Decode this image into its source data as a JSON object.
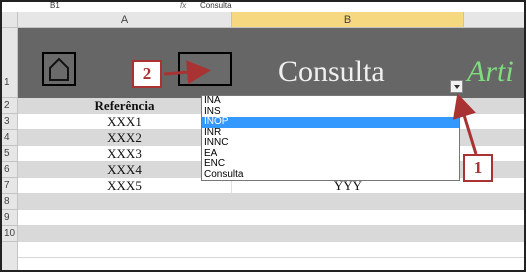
{
  "formula_bar": {
    "namebox": "B1",
    "fx": "fx",
    "content": "Consulta"
  },
  "columns": [
    "A",
    "B"
  ],
  "rows": [
    "1",
    "2",
    "3",
    "4",
    "5",
    "6",
    "7",
    "8",
    "9",
    "10"
  ],
  "title_row": {
    "title": "Consulta",
    "partial_title": "Arti"
  },
  "table": {
    "header": {
      "a": "Referência",
      "b": ""
    },
    "rows": [
      {
        "a": "XXX1",
        "b": ""
      },
      {
        "a": "XXX2",
        "b": ""
      },
      {
        "a": "XXX3",
        "b": ""
      },
      {
        "a": "XXX4",
        "b": ""
      },
      {
        "a": "XXX5",
        "b": "YYY"
      }
    ]
  },
  "dropdown": {
    "options": [
      "INA",
      "INS",
      "INOP",
      "INR",
      "INNC",
      "EA",
      "ENC",
      "Consulta"
    ],
    "selected": "INOP"
  },
  "annotations": {
    "one": "1",
    "two": "2"
  },
  "colors": {
    "title_bg": "#666666",
    "selection": "#3399ff",
    "annotation": "#a93232",
    "accent_green": "#7fdc7f"
  }
}
